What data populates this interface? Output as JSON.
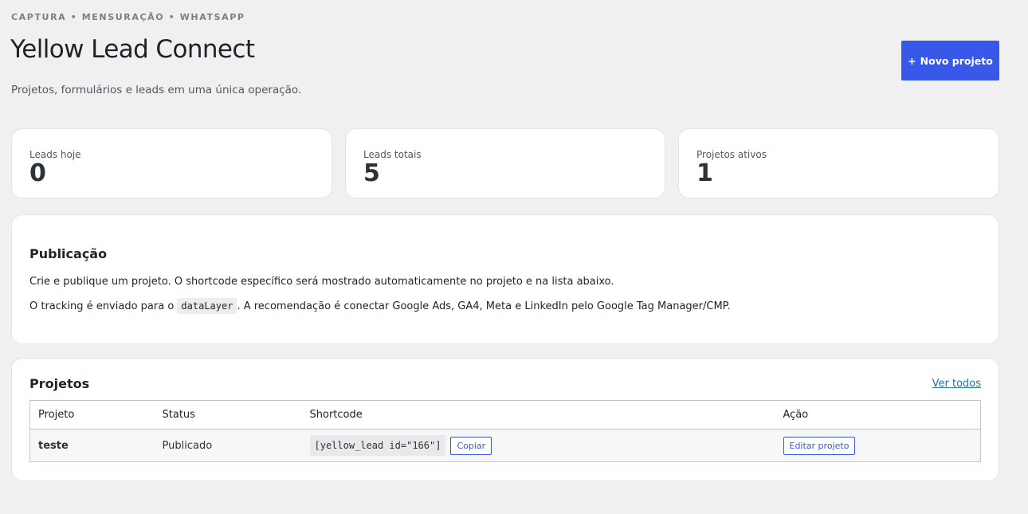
{
  "header": {
    "eyebrow": "CAPTURA • MENSURAÇÃO • WHATSAPP",
    "title": "Yellow Lead Connect",
    "subtitle": "Projetos, formulários e leads em uma única operação.",
    "new_project_plus": "+",
    "new_project_label": "Novo projeto"
  },
  "stats": [
    {
      "label": "Leads hoje",
      "value": "0"
    },
    {
      "label": "Leads totais",
      "value": "5"
    },
    {
      "label": "Projetos ativos",
      "value": "1"
    }
  ],
  "publication": {
    "title": "Publicação",
    "line1": "Crie e publique um projeto. O shortcode específico será mostrado automaticamente no projeto e na lista abaixo.",
    "line2_before": "O tracking é enviado para o",
    "line2_code": "dataLayer",
    "line2_after": ". A recomendação é conectar Google Ads, GA4, Meta e LinkedIn pelo Google Tag Manager/CMP."
  },
  "projects": {
    "title": "Projetos",
    "view_all": "Ver todos",
    "columns": [
      "Projeto",
      "Status",
      "Shortcode",
      "Ação"
    ],
    "rows": [
      {
        "name": "teste",
        "status": "Publicado",
        "shortcode": "[yellow_lead id=\"166\"]",
        "copy_label": "Copiar",
        "action_label": "Editar projeto"
      }
    ]
  },
  "colors": {
    "accent": "#3858e9",
    "link": "#2271b1",
    "background": "#f0f0f1"
  }
}
